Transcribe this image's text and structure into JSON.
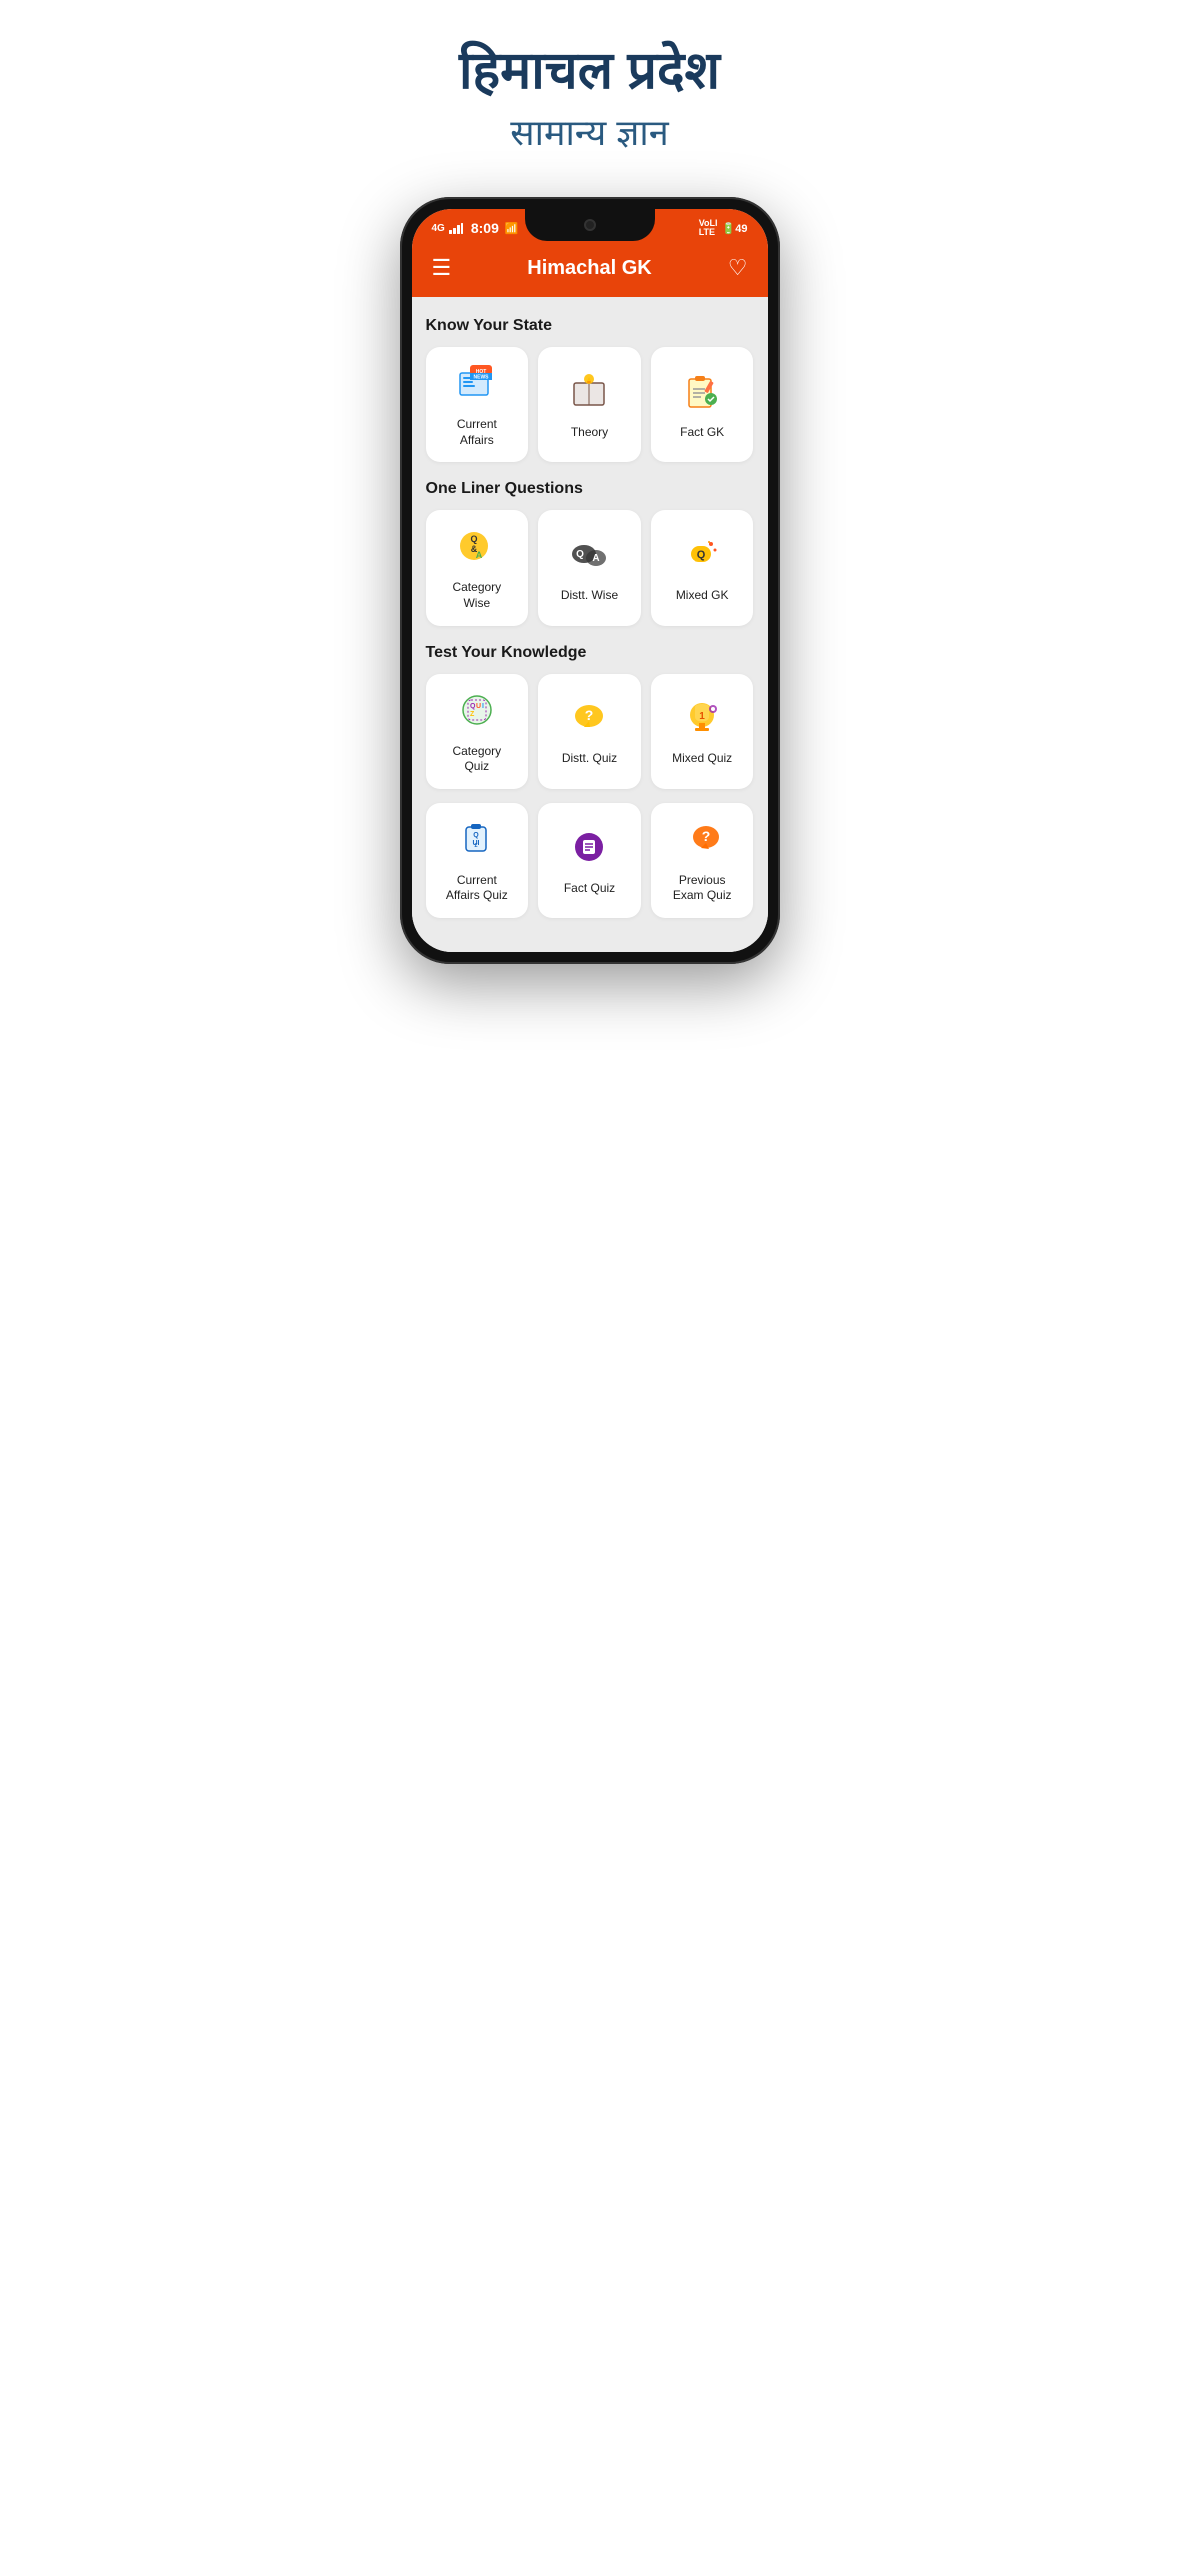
{
  "header": {
    "title_hindi": "हिमाचल प्रदेश",
    "subtitle_hindi": "सामान्य ज्ञान"
  },
  "status_bar": {
    "time": "8:09",
    "signal": "4G",
    "battery": "49"
  },
  "app_bar": {
    "title": "Himachal GK"
  },
  "sections": [
    {
      "id": "know_your_state",
      "title": "Know Your State",
      "items": [
        {
          "id": "current_affairs",
          "label": "Current\nAffairs",
          "icon": "📰"
        },
        {
          "id": "theory",
          "label": "Theory",
          "icon": "📖"
        },
        {
          "id": "fact_gk",
          "label": "Fact GK",
          "icon": "📋"
        }
      ]
    },
    {
      "id": "one_liner",
      "title": "One Liner Questions",
      "items": [
        {
          "id": "category_wise",
          "label": "Category\nWise",
          "icon": "🎯"
        },
        {
          "id": "distt_wise",
          "label": "Distt. Wise",
          "icon": "💬"
        },
        {
          "id": "mixed_gk",
          "label": "Mixed GK",
          "icon": "💡"
        }
      ]
    },
    {
      "id": "test_knowledge",
      "title": "Test Your Knowledge",
      "items_row1": [
        {
          "id": "category_quiz",
          "label": "Category\nQuiz",
          "icon": "🎲"
        },
        {
          "id": "distt_quiz",
          "label": "Distt. Quiz",
          "icon": "❓"
        },
        {
          "id": "mixed_quiz",
          "label": "Mixed Quiz",
          "icon": "🏆"
        }
      ],
      "items_row2": [
        {
          "id": "current_affairs_quiz",
          "label": "Current\nAffairs Quiz",
          "icon": "📝"
        },
        {
          "id": "fact_quiz",
          "label": "Fact Quiz",
          "icon": "🔮"
        },
        {
          "id": "previous_exam_quiz",
          "label": "Previous\nExam Quiz",
          "icon": "💬"
        }
      ]
    }
  ]
}
